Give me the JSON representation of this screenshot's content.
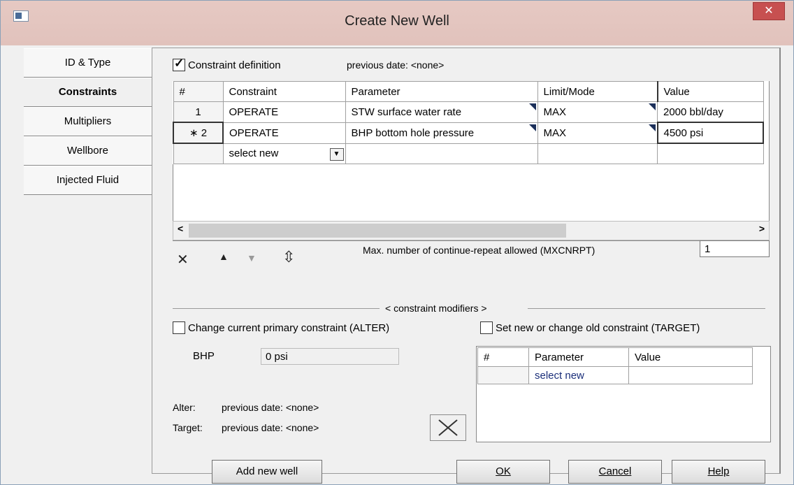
{
  "window": {
    "title": "Create New Well",
    "close_glyph": "✕"
  },
  "tabs": [
    {
      "label": "ID & Type"
    },
    {
      "label": "Constraints"
    },
    {
      "label": "Multipliers"
    },
    {
      "label": "Wellbore"
    },
    {
      "label": "Injected Fluid"
    }
  ],
  "constraint_definition": {
    "label": "Constraint definition",
    "checked": true,
    "previous_date": "previous date: <none>"
  },
  "grid": {
    "headers": [
      "#",
      "Constraint",
      "Parameter",
      "Limit/Mode",
      "Value"
    ],
    "rows": [
      {
        "num": "1",
        "constraint": "OPERATE",
        "parameter": "STW surface water rate",
        "limit": "MAX",
        "value": "2000 bbl/day"
      },
      {
        "num": "∗ 2",
        "constraint": "OPERATE",
        "parameter": "BHP bottom hole pressure",
        "limit": "MAX",
        "value": "4500 psi"
      }
    ],
    "new_row": {
      "constraint": "select new"
    }
  },
  "max_repeat": {
    "label": "Max. number of continue-repeat allowed (MXCNRPT)",
    "value": "1"
  },
  "modifiers": {
    "title": "< constraint modifiers >",
    "alter_label": "Change current primary constraint (ALTER)",
    "target_label": "Set new or change old constraint (TARGET)",
    "bhp_label": "BHP",
    "bhp_value": "0 psi",
    "alter_prev_label": "Alter:",
    "alter_prev_value": "previous date: <none>",
    "target_prev_label": "Target:",
    "target_prev_value": "previous date: <none>",
    "grid_headers": [
      "#",
      "Parameter",
      "Value"
    ],
    "grid_new": "select new"
  },
  "buttons": {
    "add_new_well": "Add new well",
    "ok": "OK",
    "cancel": "Cancel",
    "help": "Help"
  }
}
